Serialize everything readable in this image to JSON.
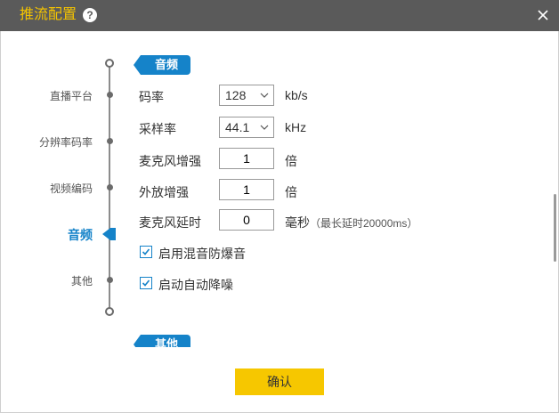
{
  "window": {
    "title": "推流配置",
    "help_icon": "?",
    "close_icon": "close-icon"
  },
  "nav": {
    "items": [
      {
        "label": "直播平台"
      },
      {
        "label": "分辨率码率"
      },
      {
        "label": "视频编码"
      },
      {
        "label": "音频",
        "active": true
      },
      {
        "label": "其他"
      }
    ]
  },
  "audio_section": {
    "header": "音频",
    "bitrate": {
      "label": "码率",
      "value": "128",
      "unit": "kb/s"
    },
    "sample_rate": {
      "label": "采样率",
      "value": "44.1",
      "unit": "kHz"
    },
    "mic_gain": {
      "label": "麦克风增强",
      "value": "1",
      "unit": "倍"
    },
    "speaker_gain": {
      "label": "外放增强",
      "value": "1",
      "unit": "倍"
    },
    "mic_delay": {
      "label": "麦克风延时",
      "value": "0",
      "unit": "毫秒",
      "note": "（最长延时20000ms）"
    },
    "anti_pop": {
      "label": "启用混音防爆音",
      "checked": true
    },
    "noise_reduction": {
      "label": "启动自动降噪",
      "checked": true
    }
  },
  "other_section": {
    "header": "其他"
  },
  "footer": {
    "confirm_label": "确认"
  },
  "colors": {
    "title_bar": "#5a5a5a",
    "title_text": "#f5c400",
    "accent_blue": "#1583c9",
    "confirm_button": "#f6c700"
  }
}
